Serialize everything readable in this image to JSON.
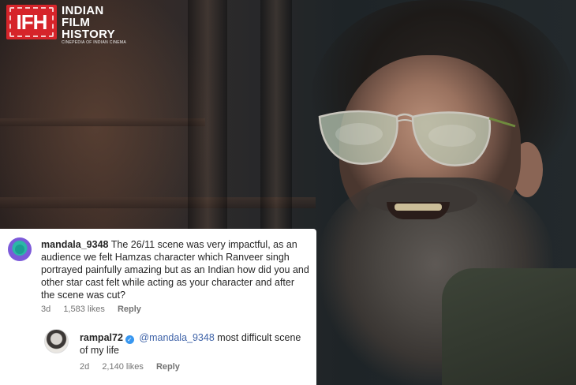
{
  "logo": {
    "mark": "IFH",
    "lines": [
      "INDIAN",
      "FILM",
      "HISTORY"
    ],
    "tagline": "CINEPEDIA OF INDIAN CINEMA",
    "brand_color": "#d6242a"
  },
  "comment": {
    "username": "mandala_9348",
    "text": "The 26/11 scene was very impactful, as an audience we felt Hamzas character which Ranveer singh portrayed painfully amazing but as an Indian how did you and other star cast felt while acting as your character and after the scene was cut?",
    "age": "3d",
    "likes": "1,583 likes",
    "reply_label": "Reply"
  },
  "reply": {
    "username": "rampal72",
    "verified_icon": "verified-badge-icon",
    "mention": "@mandala_9348",
    "text": "most difficult scene of my life",
    "age": "2d",
    "likes": "2,140 likes",
    "reply_label": "Reply"
  },
  "colors": {
    "verified": "#3897f0",
    "mention": "#3f63a8",
    "meta_text": "#737373"
  }
}
